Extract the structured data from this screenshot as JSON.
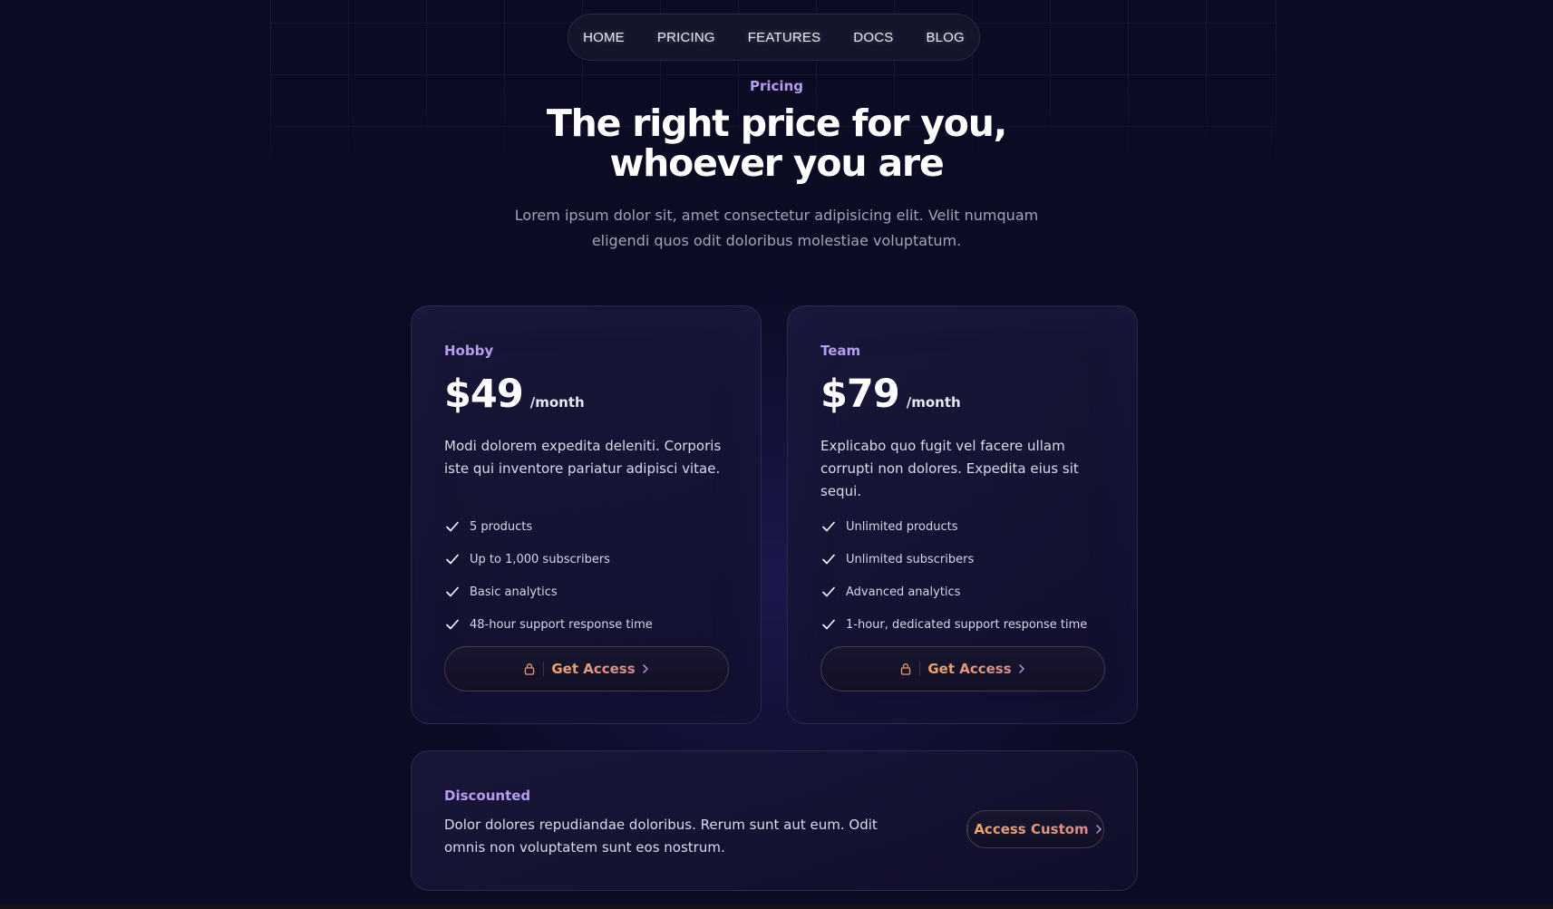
{
  "nav": {
    "items": [
      "HOME",
      "PRICING",
      "FEATURES",
      "DOCS",
      "BLOG"
    ]
  },
  "header": {
    "eyebrow": "Pricing",
    "title": "The right price for you, whoever you are",
    "subtitle": "Lorem ipsum dolor sit, amet consectetur adipisicing elit. Velit numquam eligendi quos odit doloribus molestiae voluptatum."
  },
  "plans": [
    {
      "name": "Hobby",
      "price": "$49",
      "period": "/month",
      "description": "Modi dolorem expedita deleniti. Corporis iste qui inventore pariatur adipisci vitae.",
      "features": [
        "5 products",
        "Up to 1,000 subscribers",
        "Basic analytics",
        "48-hour support response time"
      ],
      "cta": "Get Access"
    },
    {
      "name": "Team",
      "price": "$79",
      "period": "/month",
      "description": "Explicabo quo fugit vel facere ullam corrupti non dolores. Expedita eius sit sequi.",
      "features": [
        "Unlimited products",
        "Unlimited subscribers",
        "Advanced analytics",
        "1-hour, dedicated support response time"
      ],
      "cta": "Get Access"
    }
  ],
  "discounted": {
    "name": "Discounted",
    "description": "Dolor dolores repudiandae doloribus. Rerum sunt aut eum. Odit omnis non voluptatem sunt eos nostrum.",
    "cta": "Access Custom"
  },
  "colors": {
    "background": "#0b0b24",
    "accent": "#b79cf0",
    "cta_gradient_start": "#f0a56a",
    "cta_gradient_end": "#d98a8f"
  },
  "icons": {
    "feature": "check-icon",
    "cta_lock": "lock-icon",
    "cta_arrow": "chevron-right-icon"
  }
}
